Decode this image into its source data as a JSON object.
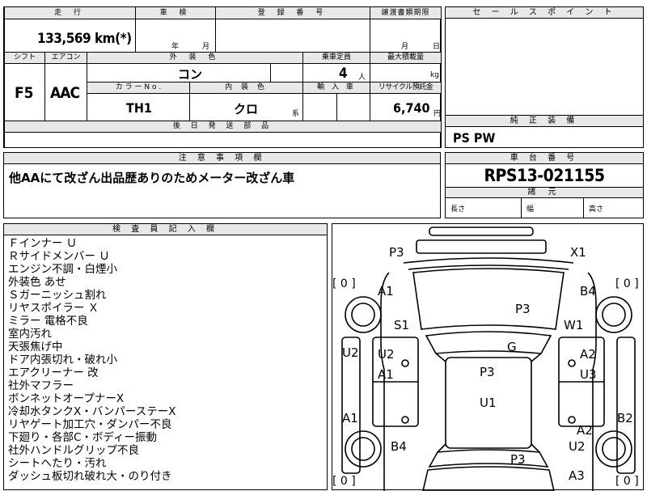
{
  "top": {
    "mileage_header": "走 行",
    "mileage_value": "133,569",
    "mileage_unit": "km(*)",
    "shaken_header": "車 検",
    "shaken_year": "年",
    "shaken_month": "月",
    "reg_header": "登 録 番 号",
    "transfer_header": "譲渡書類期限",
    "transfer_month": "月",
    "transfer_day": "日",
    "shift_header": "シフト",
    "ac_header": "エアコン",
    "exterior_header": "外 装 色",
    "seats_header": "乗車定員",
    "maxload_header": "最大積載量",
    "shift_value": "F5",
    "ac_value": "AAC",
    "exterior_value": "コン",
    "seats_value": "4",
    "seats_unit": "人",
    "maxload_unit": "kg",
    "color_no_header": "カ ラ ー N o .",
    "interior_header": "内 装 色",
    "import_header": "輸 入 車",
    "recycle_header": "リサイクル預託金",
    "color_no_value": "TH1",
    "interior_value": "クロ",
    "interior_suffix": "系",
    "recycle_value": "6,740",
    "recycle_unit": "円",
    "later_parts_header": "後 日 発 送 部 品"
  },
  "sales": {
    "header": "セ ー ル ス ポ イ ン ト"
  },
  "equipment": {
    "header": "純 正 装 備",
    "value": "PS PW"
  },
  "notes": {
    "header": "注 意 事 項 欄",
    "text": "他AAにて改ざん出品歴ありのためメーター改ざん車"
  },
  "chassis": {
    "header": "車 台 番 号",
    "value": "RPS13-021155",
    "dims_header": "諸 元",
    "length_label": "長さ",
    "width_label": "幅",
    "height_label": "高さ"
  },
  "inspector": {
    "header": "検 査 員 記 入 欄",
    "lines": [
      "Ｆインナー Ｕ",
      "Ｒサイドメンバー Ｕ",
      "エンジン不調・白煙小",
      "外装色 あせ",
      "Ｓガーニッシュ割れ",
      "リヤスポイラー Ｘ",
      "ミラー 電格不良",
      "室内汚れ",
      "天張焦げ中",
      "ドア内張切れ・破れ小",
      "エアクリーナー 改",
      "社外マフラー",
      "ボンネットオープナーX",
      "冷却水タンクX・バンパーステーX",
      "リヤゲート加工穴・ダンパー不良",
      "下廻り・各部C・ボディー振動",
      "社外ハンドルグリップ不良",
      "シートへたり・汚れ",
      "ダッシュ板切れ破れ大・のり付き"
    ]
  },
  "diagram": {
    "marks": [
      "P3",
      "X1",
      "A1",
      "B4",
      "P3",
      "S1",
      "W1",
      "G",
      "U2",
      "A2",
      "A1",
      "U3",
      "P3",
      "U2",
      "U1",
      "A2",
      "A1",
      "B2",
      "B4",
      "U2",
      "P3",
      "A3"
    ],
    "tire_labels": [
      "[ 0 ]",
      "[ 0 ]",
      "[ 0 ]",
      "[ 0 ]"
    ]
  }
}
